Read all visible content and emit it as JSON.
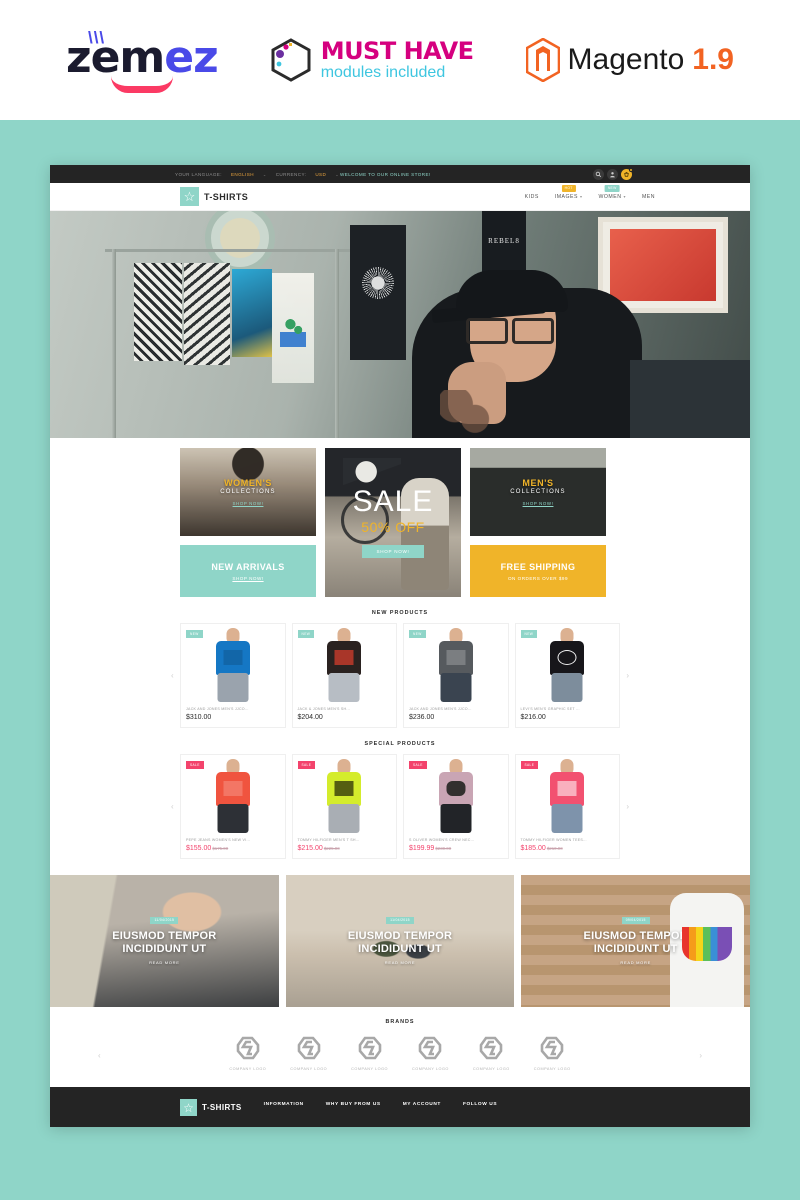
{
  "promo_header": {
    "zemez": {
      "text_dark": "zem",
      "text_blue": "ez",
      "ticks": "\\\\\\"
    },
    "must_have": {
      "title": "MUST HAVE",
      "subtitle": "modules included"
    },
    "magento": {
      "name": "Magento",
      "version": "1.9"
    }
  },
  "site": {
    "topbar": {
      "language_label": "YOUR LANGUAGE:",
      "language_value": "ENGLISH",
      "currency_label": "CURRENCY:",
      "currency_value": "USD",
      "welcome": "WELCOME TO OUR ONLINE STORE!",
      "caret": "⌄",
      "icons": {
        "search": "search-icon",
        "account": "account-icon",
        "cart": "cart-icon"
      }
    },
    "header": {
      "brand_name": "T-SHIRTS",
      "brand_glyph": "☆",
      "nav": [
        {
          "label": "KIDS",
          "badge": "",
          "has_dropdown": false
        },
        {
          "label": "IMAGES",
          "badge": "HOT",
          "has_dropdown": true
        },
        {
          "label": "WOMEN",
          "badge": "NEW",
          "has_dropdown": true
        },
        {
          "label": "MEN",
          "badge": "",
          "has_dropdown": false
        }
      ]
    },
    "banners": {
      "women": {
        "title": "WOMEN'S",
        "subtitle": "COLLECTIONS",
        "link": "SHOP NOW!"
      },
      "men": {
        "title": "MEN'S",
        "subtitle": "COLLECTIONS",
        "link": "SHOP NOW!"
      },
      "sale": {
        "title": "SALE",
        "discount": "50% OFF",
        "button": "SHOP NOW!"
      },
      "new_arrivals": {
        "title": "NEW ARRIVALS",
        "link": "SHOP NOW!"
      },
      "free_shipping": {
        "title": "FREE SHIPPING",
        "subtitle": "ON ORDERS OVER $99"
      }
    },
    "new_products": {
      "title": "NEW PRODUCTS",
      "items": [
        {
          "badge": "NEW",
          "name": "JACK AND JONES MEN'S JJCO...",
          "price": "$310.00"
        },
        {
          "badge": "NEW",
          "name": "JACK & JONES MEN'S SH...",
          "price": "$204.00"
        },
        {
          "badge": "NEW",
          "name": "JACK AND JONES MEN'S JJCO...",
          "price": "$236.00"
        },
        {
          "badge": "NEW",
          "name": "LEVI'S MEN'S GRAPHIC SET ...",
          "price": "$216.00"
        }
      ]
    },
    "special_products": {
      "title": "SPECIAL PRODUCTS",
      "items": [
        {
          "badge": "SALE",
          "name": "PEPE JEANS WOMEN'S NEW VI...",
          "price": "$155.00",
          "old_price": "$175.00"
        },
        {
          "badge": "SALE",
          "name": "TOMMY HILFIGER MEN'S T SH...",
          "price": "$215.00",
          "old_price": "$225.00"
        },
        {
          "badge": "SALE",
          "name": "S OLIVER WOMEN'S CREW NEC...",
          "price": "$199.99",
          "old_price": "$230.00"
        },
        {
          "badge": "SALE",
          "name": "TOMMY HILFIGER WOMEN TEES...",
          "price": "$185.00",
          "old_price": "$210.00"
        }
      ]
    },
    "blog_posts": [
      {
        "date": "11/04/2015",
        "title": "EIUSMOD TEMPOR INCIDIDUNT UT",
        "read_more": "READ MORE"
      },
      {
        "date": "11/04/2015",
        "title": "EIUSMOD TEMPOR INCIDIDUNT UT",
        "read_more": "READ MORE"
      },
      {
        "date": "09/04/2015",
        "title": "EIUSMOD TEMPOR INCIDIDUNT UT",
        "read_more": "READ MORE"
      }
    ],
    "brands": {
      "title": "BRANDS",
      "items": [
        {
          "label": "COMPANY LOGO"
        },
        {
          "label": "COMPANY LOGO"
        },
        {
          "label": "COMPANY LOGO"
        },
        {
          "label": "COMPANY LOGO"
        },
        {
          "label": "COMPANY LOGO"
        },
        {
          "label": "COMPANY LOGO"
        }
      ]
    },
    "footer": {
      "brand_name": "T-SHIRTS",
      "brand_glyph": "☆",
      "columns": [
        {
          "title": "INFORMATION"
        },
        {
          "title": "WHY BUY FROM US"
        },
        {
          "title": "MY ACCOUNT"
        },
        {
          "title": "FOLLOW US"
        }
      ]
    },
    "colors": {
      "teal": "#8fd5c8",
      "amber": "#f0b429",
      "pink": "#f3436c",
      "dark": "#242424"
    }
  }
}
